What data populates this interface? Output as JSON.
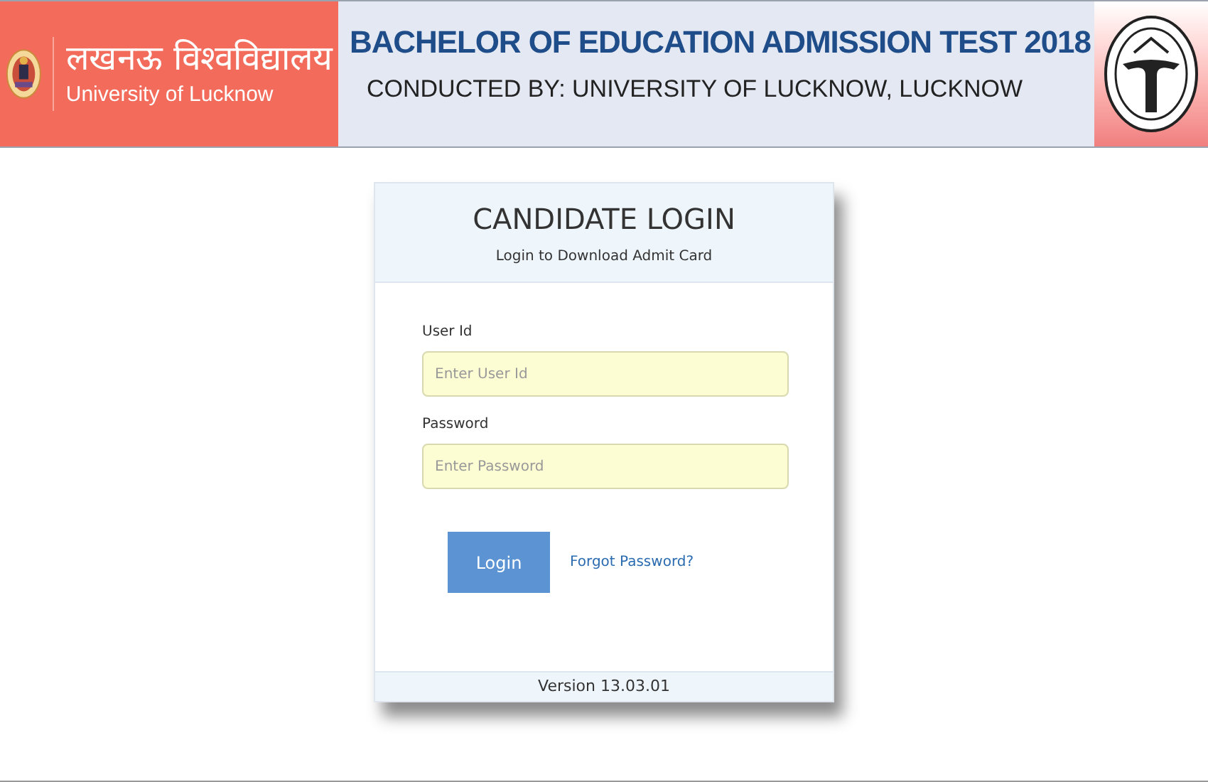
{
  "header": {
    "university_hindi": "लखनऊ विश्वविद्यालय",
    "university_english": "University of Lucknow",
    "title": "BACHELOR OF EDUCATION ADMISSION TEST 2018",
    "subtitle": "CONDUCTED BY: UNIVERSITY OF LUCKNOW, LUCKNOW"
  },
  "login": {
    "title": "CANDIDATE LOGIN",
    "subtitle": "Login to Download Admit Card",
    "fields": [
      {
        "label": "User Id",
        "placeholder": "Enter User Id"
      },
      {
        "label": "Password",
        "placeholder": "Enter Password"
      }
    ],
    "button": "Login",
    "link": "Forgot Password?",
    "version": "Version 13.03.01"
  }
}
